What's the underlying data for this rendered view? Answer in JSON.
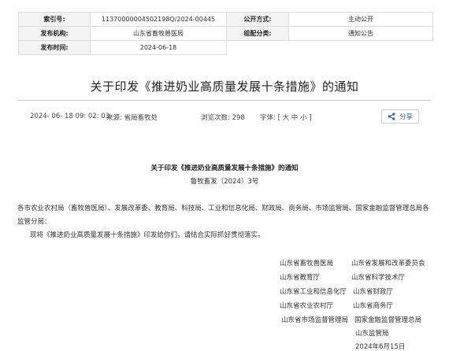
{
  "meta": {
    "index_label": "索引号:",
    "index_value": "11370000004502198Q/2024-00445",
    "open_label": "公开方式:",
    "open_value": "主动公开",
    "issuer_label": "发布机构:",
    "issuer_value": "山东省畜牧兽医局",
    "category_label": "组配分类:",
    "category_value": "通知公告",
    "date_label": "发布时间:",
    "date_value": "2024-06-18"
  },
  "title": "关于印发《推进奶业高质量发展十条措施》的通知",
  "info": {
    "datetime": "2024- 06- 18 09: 02: 03",
    "source": "来源:  省局畜牧处",
    "views": "浏览次数: 298",
    "font_size": "字体: [ 大 中 小 ]"
  },
  "share_label": "分享",
  "doc": {
    "title": "关于印发《推进奶业高质量发展十条措施》的通知",
    "number": "鲁牧畜发〔2024〕3号",
    "recipients": "各市农业农村局（畜牧兽医局）、发展改革委、教育局、科技局、工业和信息化局、财政局、商务局、市场监管局、国家金融监督管理总局各监管分局：",
    "body": "现将《推进奶业高质量发展十条措施》印发给你们，请结合实际抓好贯彻落实。"
  },
  "signatories": [
    "山东省畜牧兽医局",
    "山东省发展和改革委员会",
    "山东省教育厅",
    "山东省科学技术厅",
    "山东省工业和信息化厅",
    "山东省财政厅",
    "山东省农业农村厅",
    "山东省商务厅",
    "山东省市场监督管理局",
    "国家金融监督管理总局",
    "山东监管局"
  ],
  "sign_date": "2024年6月15日"
}
